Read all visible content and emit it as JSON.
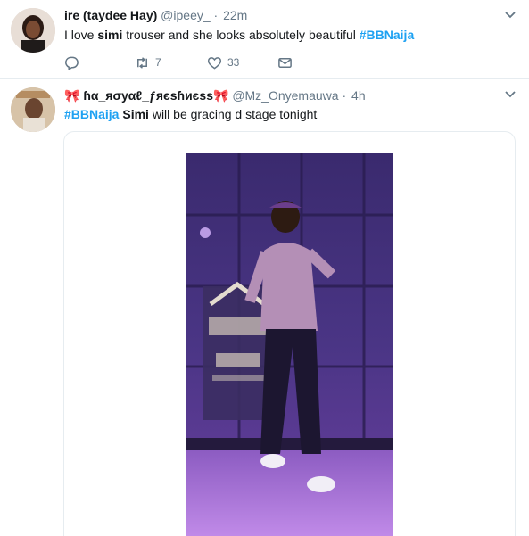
{
  "tweets": [
    {
      "name": "ire (taydee Hay)",
      "handle": "@ipeey_",
      "separator": "·",
      "time": "22m",
      "text_segments": [
        "I love ",
        "simi",
        "  trouser and she looks absolutely beautiful ",
        "#BBNaija"
      ],
      "actions": {
        "retweets": "7",
        "likes": "33"
      }
    },
    {
      "name": "ɦα_яσуαℓ_ƒяєѕɦиєѕѕ",
      "emoji_left": "🎀",
      "emoji_right": "🎀",
      "handle": "@Mz_Onyemauwa",
      "separator": "·",
      "time": "4h",
      "text_segments": [
        "#BBNaija",
        " ",
        "Simi",
        " will be gracing d stage tonight"
      ]
    }
  ],
  "icons": [
    "reply-icon",
    "retweet-icon",
    "like-icon",
    "direct-message-icon",
    "caret-down-icon"
  ],
  "colors": {
    "link": "#1da1f2",
    "muted": "#657786",
    "border": "#e6ecf0",
    "text": "#14171a"
  }
}
